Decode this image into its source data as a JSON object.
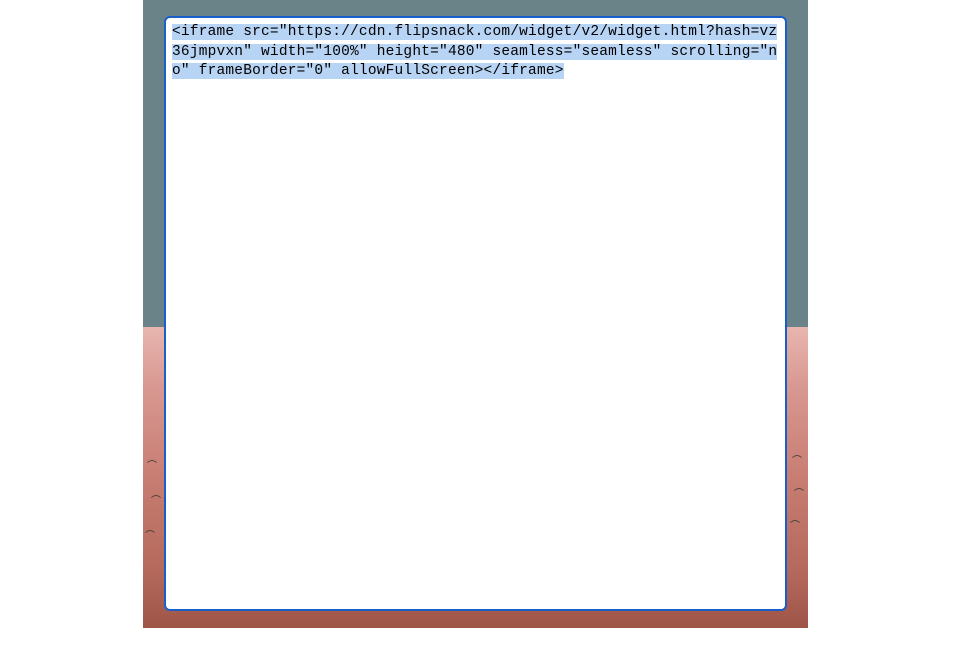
{
  "editor": {
    "code_content": "<iframe src=\"https://cdn.flipsnack.com/widget/v2/widget.html?hash=vz36jmpvxn\" width=\"100%\" height=\"480\" seamless=\"seamless\" scrolling=\"no\" frameBorder=\"0\" allowFullScreen></iframe>",
    "selection_highlighted": true
  },
  "colors": {
    "border": "#1a5fc9",
    "highlight": "#b8d4f5",
    "background_top": "#6a8388",
    "background_bottom": "#c87d72"
  }
}
